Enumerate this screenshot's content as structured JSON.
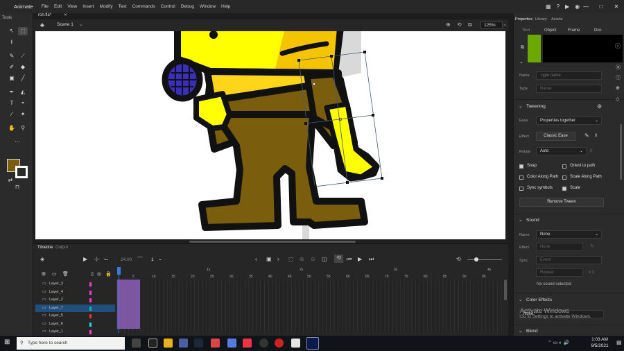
{
  "app": {
    "name": "Animate"
  },
  "menu": [
    "File",
    "Edit",
    "View",
    "Insert",
    "Modify",
    "Text",
    "Commands",
    "Control",
    "Debug",
    "Window",
    "Help"
  ],
  "window_controls": [
    "—",
    "□",
    "✕"
  ],
  "document": {
    "tab": "ron.fla*",
    "scene": "Scene 1",
    "zoom": "125%"
  },
  "tools": {
    "title": "Tools"
  },
  "timeline": {
    "tabs": [
      "Timeline",
      "Output"
    ],
    "fps": "24.00",
    "fps_unit": "FPS",
    "current_frame": "1",
    "time_markers": [
      "1s",
      "2s",
      "3s",
      "4s"
    ],
    "frame_numbers": [
      "5",
      "10",
      "15",
      "20",
      "25",
      "30",
      "35",
      "40",
      "45",
      "50",
      "55",
      "60",
      "65",
      "70",
      "75",
      "80",
      "85",
      "90",
      "95"
    ],
    "layers": [
      {
        "name": "Layer_3",
        "color": "#ff3bd0"
      },
      {
        "name": "Layer_4",
        "color": "#ff3bd0"
      },
      {
        "name": "Layer_2",
        "color": "#ff3bd0"
      },
      {
        "name": "Layer_7",
        "color": "#14b8a6"
      },
      {
        "name": "Layer_5",
        "color": "#ff3030"
      },
      {
        "name": "Layer_6",
        "color": "#22d3ee"
      },
      {
        "name": "Layer_1",
        "color": "#ff3bd0"
      }
    ],
    "active_layer": "Layer_7"
  },
  "properties": {
    "tabs": [
      "Properties",
      "Library",
      "Assets"
    ],
    "subtabs": [
      "Tool",
      "Object",
      "Frame",
      "Doc"
    ],
    "active_subtab": "Frame",
    "frame_color": "#6aaa00",
    "label": {
      "name_label": "Name",
      "name_placeholder": "Type name",
      "type_label": "Type",
      "type_value": "Name"
    },
    "tweening": {
      "header": "Tweening",
      "ease_label": "Ease",
      "ease_value": "Properties together",
      "effect_label": "Effect",
      "effect_value": "Classic Ease",
      "effect_amount": "0",
      "rotate_label": "Rotate",
      "rotate_value": "Auto",
      "rotate_amount": "0",
      "options": [
        {
          "label": "Snap",
          "checked": true
        },
        {
          "label": "Orient to path",
          "checked": false
        },
        {
          "label": "Color Along Path",
          "checked": false
        },
        {
          "label": "Scale Along Path",
          "checked": false
        },
        {
          "label": "Sync symbols",
          "checked": false
        },
        {
          "label": "Scale",
          "checked": true
        }
      ],
      "remove_button": "Remove Tween"
    },
    "sound": {
      "header": "Sound",
      "name_label": "Name",
      "name_value": "None",
      "effect_label": "Effect",
      "effect_value": "None",
      "sync_label": "Sync",
      "sync_value": "Event",
      "repeat_value": "Repeat",
      "repeat_count": "x 1",
      "status": "No sound selected"
    },
    "color_effects": {
      "header": "Color Effects",
      "value": "None"
    },
    "blend": {
      "header": "Blend"
    }
  },
  "activate_windows": {
    "title": "Activate Windows",
    "subtitle": "Go to Settings to activate Windows."
  },
  "taskbar": {
    "search_placeholder": "Type here to search",
    "time": "1:03 AM",
    "date": "9/5/2021"
  }
}
